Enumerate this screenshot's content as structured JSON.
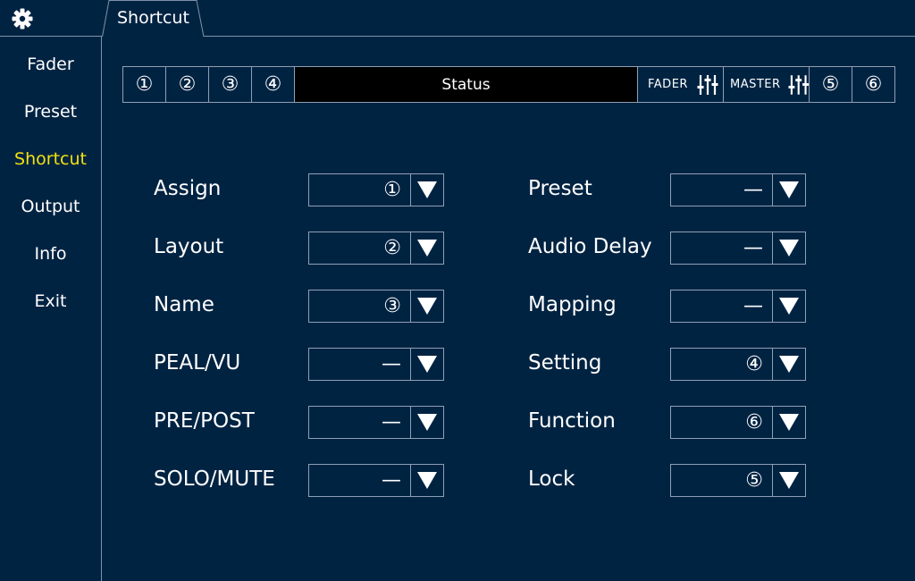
{
  "header": {
    "settings_icon": "gear-icon",
    "active_tab": "Shortcut"
  },
  "sidebar": {
    "items": [
      {
        "label": "Fader"
      },
      {
        "label": "Preset"
      },
      {
        "label": "Shortcut"
      },
      {
        "label": "Output"
      },
      {
        "label": "Info"
      },
      {
        "label": "Exit"
      }
    ],
    "active": "Shortcut"
  },
  "strip": {
    "slot1": "①",
    "slot2": "②",
    "slot3": "③",
    "slot4": "④",
    "status": "Status",
    "fader": "FADER",
    "master": "MASTER",
    "slot5": "⑤",
    "slot6": "⑥",
    "fader_icon": "sliders-icon",
    "master_icon": "sliders-icon"
  },
  "left_rows": [
    {
      "label": "Assign",
      "value": "①"
    },
    {
      "label": "Layout",
      "value": "②"
    },
    {
      "label": "Name",
      "value": "③"
    },
    {
      "label": "PEAL/VU",
      "value": "—"
    },
    {
      "label": "PRE/POST",
      "value": "—"
    },
    {
      "label": "SOLO/MUTE",
      "value": "—"
    }
  ],
  "right_rows": [
    {
      "label": "Preset",
      "value": "—"
    },
    {
      "label": "Audio Delay",
      "value": "—"
    },
    {
      "label": "Mapping",
      "value": "—"
    },
    {
      "label": "Setting",
      "value": "④"
    },
    {
      "label": "Function",
      "value": "⑥"
    },
    {
      "label": "Lock",
      "value": "⑤"
    }
  ],
  "colors": {
    "background": "#012342",
    "active_text": "#f0e210",
    "border": "#8da0b4",
    "status_bg": "#000000"
  }
}
